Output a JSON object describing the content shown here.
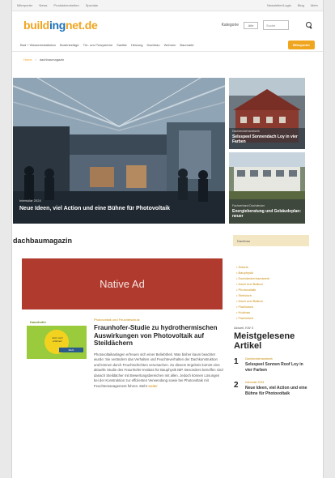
{
  "topbar": {
    "links_left": [
      "Mitreporter",
      "News",
      "Produktneuheiten",
      "Specials"
    ],
    "links_right": [
      "Newsletter/Login",
      "Blog",
      "Mehr"
    ]
  },
  "header": {
    "logo_a": "build",
    "logo_b": "ing",
    "logo_c": "net.de",
    "kategorie_label": "Kategorie",
    "select_value": "Alle",
    "search_placeholder": "Suche"
  },
  "nav": {
    "items": [
      "Bad + Wasserinstallation",
      "Bodenbeläge",
      "Tür- und Torsysteme",
      "Sanitär",
      "Heizung",
      "Dachbau",
      "Wohnen",
      "Baumarkt"
    ],
    "button_label": "Mitreporter"
  },
  "breadcrumb": {
    "home": "Home",
    "separator": "/",
    "current": "dachbaumagazin"
  },
  "hero": {
    "kicker": "Intersolar 2024",
    "title": "Neue Ideen, viel Action und eine Bühne für Photovoltaik"
  },
  "side_teasers": [
    {
      "kicker": "Dachdeckerhandwerk",
      "title": "Selsspeel Sonnendach Loy in vier Farben"
    },
    {
      "kicker": "Fachverband Dachdecker",
      "title": "Energieberatung und Gebäudeplan: neuer"
    }
  ],
  "section_title": "dachbaumagazin",
  "native_ad": {
    "label": "Native Ad"
  },
  "sidebar": {
    "heading": "Dachbau",
    "items": [
      "Solaris",
      "Bauphysik",
      "Dachdeckerhandwerk",
      "Dach und Balkon",
      "Photovoltaik",
      "Steildach",
      "Dach und Balkon",
      "Flachdach",
      "Holzbau",
      "Flachdach"
    ]
  },
  "article": {
    "thumb_logo": "fraunhofer",
    "thumb_text": "Jetzt mehr erfahren!",
    "thumb_button": "Mehr",
    "kicker": "Photovoltaik und Feuchteschutz",
    "title": "Fraunhofer-Studie zu hydrothermischen Auswirkungen von Photovoltaik auf Steildächern",
    "body": "Photovoltaikanlagen erfreuen sich einer Beliebtheit. Was bisher kaum beachtet wurde: Sie verändern das Verhalten und Feuchteverhalten der Dachkonstruktion und können durch Feuchtschichten verursachen. Zu diesem Ergebnis kommt eine aktuelle Studie des Fraunhofer-Instituts für Bauphysik IBP. Besonders betroffen sind danach Steildächer mit Bewertungsbereichen mit allen. Jedoch können Lösungen bei der Konstruktion zur effizienten Verwendung sowie bei Photovoltaik mit Feuchtemanagement führen. Mehr",
    "more": "weiter"
  },
  "mostread": {
    "kicker": "Aktuell, KW 3",
    "title": "Meistgelesene Artikel",
    "items": [
      {
        "num": "1",
        "kicker": "Dachdeckerhandwerk",
        "title": "Selsspeel Sonnen Roof Loy in vier Farben"
      },
      {
        "num": "2",
        "kicker": "Intersolar 2024",
        "title": "Neue Ideen, viel Action und eine Bühne für Photovoltaik"
      }
    ]
  }
}
